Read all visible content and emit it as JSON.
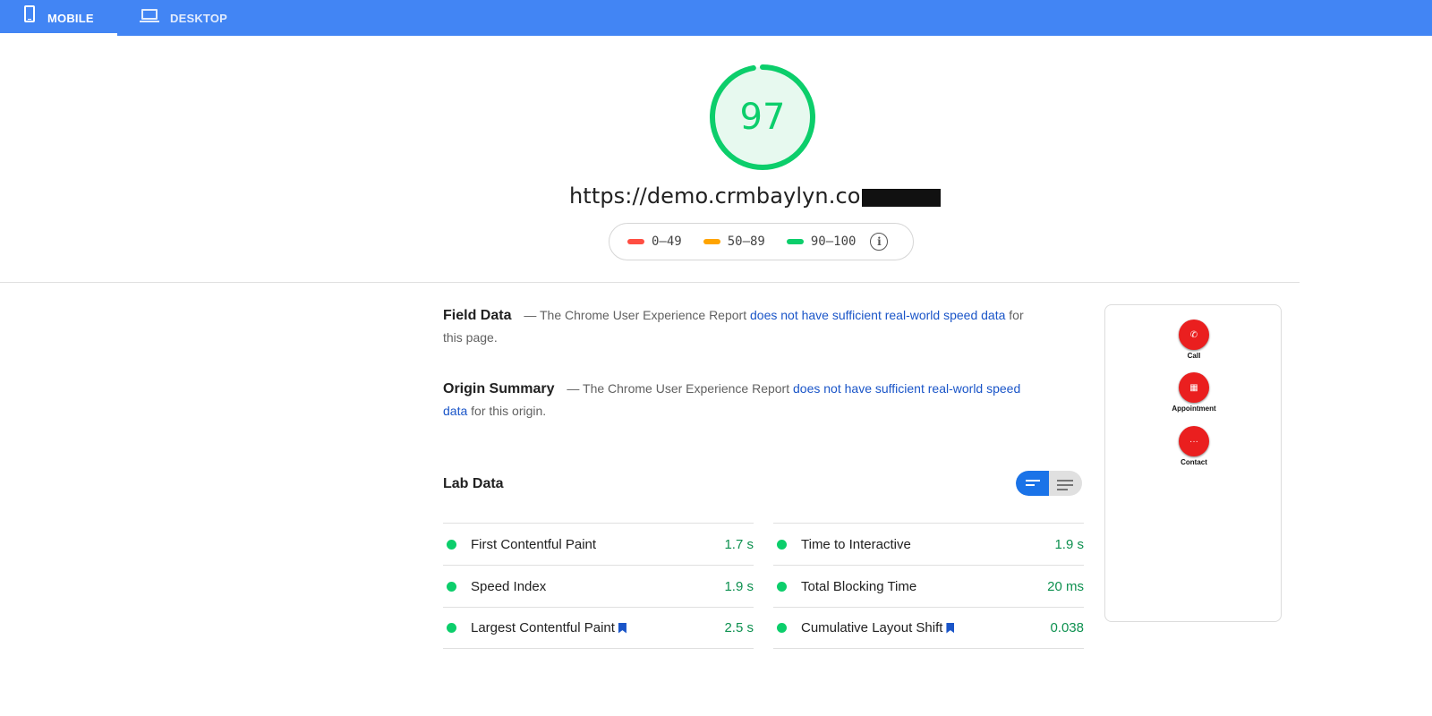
{
  "tabs": [
    {
      "label": "MOBILE",
      "icon": "phone-icon",
      "active": true
    },
    {
      "label": "DESKTOP",
      "icon": "laptop-icon",
      "active": false
    }
  ],
  "score": {
    "value": "97",
    "fraction": 0.97,
    "color": "#0cce6b"
  },
  "url": "https://demo.crmbaylyn.com",
  "legend": [
    {
      "range": "0–49",
      "color": "#ff4e42"
    },
    {
      "range": "50–89",
      "color": "#ffa400"
    },
    {
      "range": "90–100",
      "color": "#0cce6b"
    }
  ],
  "field_data": {
    "title": "Field Data",
    "dash": "—",
    "text_before": "The Chrome User Experience Report",
    "link": "does not have sufficient real-world speed data",
    "text_after": "for this page."
  },
  "origin_summary": {
    "title": "Origin Summary",
    "dash": "—",
    "text_before": "The Chrome User Experience Report",
    "link": "does not have sufficient real-world speed data",
    "text_after": "for this origin."
  },
  "lab_data": {
    "title": "Lab Data",
    "left": [
      {
        "label": "First Contentful Paint",
        "value": "1.7 s",
        "bookmark": false
      },
      {
        "label": "Speed Index",
        "value": "1.9 s",
        "bookmark": false
      },
      {
        "label": "Largest Contentful Paint",
        "value": "2.5 s",
        "bookmark": true
      }
    ],
    "right": [
      {
        "label": "Time to Interactive",
        "value": "1.9 s",
        "bookmark": false
      },
      {
        "label": "Total Blocking Time",
        "value": "20 ms",
        "bookmark": false
      },
      {
        "label": "Cumulative Layout Shift",
        "value": "0.038",
        "bookmark": true
      }
    ]
  },
  "preview": {
    "buttons": [
      {
        "label": "Call",
        "icon": "phone-icon",
        "glyph": "✆"
      },
      {
        "label": "Appointment",
        "icon": "calendar-icon",
        "glyph": "▦"
      },
      {
        "label": "Contact",
        "icon": "more-icon",
        "glyph": "···"
      }
    ]
  }
}
